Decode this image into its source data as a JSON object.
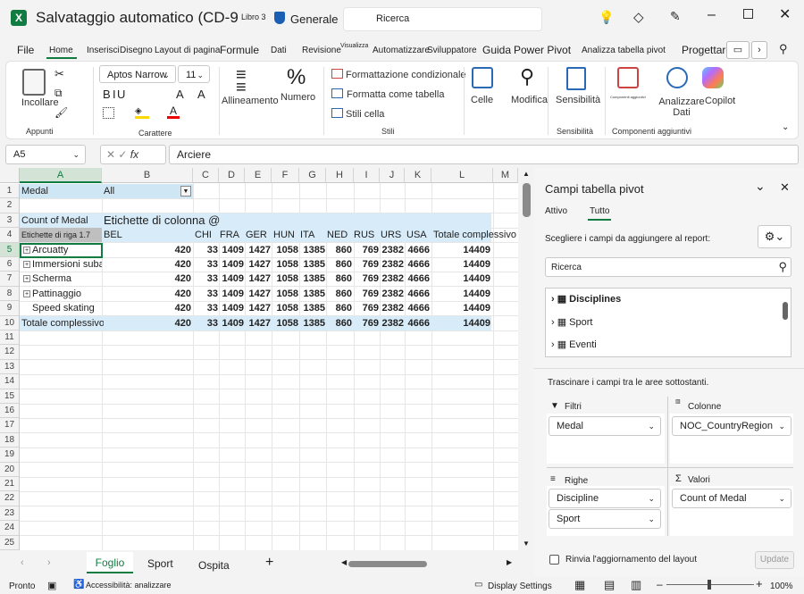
{
  "titlebar": {
    "app_icon": "excel-icon",
    "title": "Salvataggio automatico (CD-9",
    "file_badge": "Libro 3",
    "sensitivity": "Generale p",
    "search_placeholder": "Ricerca",
    "icons": [
      "lightbulb-icon",
      "diamond-icon",
      "pen-icon",
      "minimize-icon",
      "maximize-icon",
      "close-icon"
    ]
  },
  "tabs": [
    "File",
    "Home",
    "Inserisci",
    "Disegno",
    "Layout di pagina",
    "Formule",
    "Dati",
    "Revisione",
    "Visualizza",
    "Automatizzare",
    "Sviluppatore",
    "Guida",
    "Power Pivot",
    "Analizza tabella pivot",
    "Progettare"
  ],
  "ribbon": {
    "clipboard": {
      "paste_label": "Incollare",
      "group_label": "Appunti"
    },
    "font": {
      "font_name": "Aptos Narrow",
      "font_size": "11",
      "bold": "B",
      "italic": "I",
      "underline": "U",
      "grow": "A",
      "shrink": "A",
      "group_label": "Carattere"
    },
    "alignment": {
      "label": "Allineamento"
    },
    "number": {
      "label": "Numero"
    },
    "styles": {
      "conditional": "Formattazione condizionale",
      "as_table": "Formatta come tabella",
      "cell_styles": "Stili cella",
      "group_label": "Stili"
    },
    "cells": {
      "label": "Celle"
    },
    "edit": {
      "label": "Modifica"
    },
    "sensitivity": {
      "label": "Sensibilità",
      "group_label": "Sensibilità"
    },
    "addins": {
      "label": "Componenti aggiuntivi",
      "group_label": "Componenti aggiuntivi"
    },
    "analyze": {
      "label": "Analizzare Dati"
    },
    "copilot": {
      "label": "Copilot"
    }
  },
  "formulabar": {
    "namebox": "A5",
    "fx": "fx",
    "value": "Arciere"
  },
  "columns": [
    "A",
    "B",
    "C",
    "D",
    "E",
    "F",
    "G",
    "H",
    "I",
    "J",
    "K",
    "L",
    "M"
  ],
  "rows": [
    "1",
    "2",
    "3",
    "4",
    "5",
    "6",
    "7",
    "8",
    "9",
    "10",
    "11",
    "12",
    "13",
    "14",
    "15",
    "16",
    "17",
    "18",
    "19",
    "20",
    "21",
    "22",
    "23",
    "24",
    "25"
  ],
  "pivot": {
    "filter_label": "Medal",
    "filter_value": "All",
    "count_label": "Count of Medal",
    "col_labels": "Etichette di colonna @",
    "row_labels": "Etichette di riga 1.7",
    "headers": [
      "BEL",
      "CHI",
      "FRA",
      "GER",
      "HUN",
      "ITA",
      "NED",
      "RUS",
      "URS",
      "USA",
      "Totale complessivo"
    ],
    "rows": [
      {
        "label": "Arcuatty",
        "values": [
          "420",
          "33",
          "1409",
          "1427",
          "1058",
          "1385",
          "860",
          "769",
          "2382",
          "4666",
          "14409"
        ]
      },
      {
        "label": "Immersioni subacquee",
        "values": [
          "420",
          "33",
          "1409",
          "1427",
          "1058",
          "1385",
          "860",
          "769",
          "2382",
          "4666",
          "14409"
        ]
      },
      {
        "label": "Scherma",
        "values": [
          "420",
          "33",
          "1409",
          "1427",
          "1058",
          "1385",
          "860",
          "769",
          "2382",
          "4666",
          "14409"
        ]
      },
      {
        "label": "Pattinaggio",
        "values": [
          "420",
          "33",
          "1409",
          "1427",
          "1058",
          "1385",
          "860",
          "769",
          "2382",
          "4666",
          "14409"
        ]
      },
      {
        "label": "Speed skating",
        "values": [
          "420",
          "33",
          "1409",
          "1427",
          "1058",
          "1385",
          "860",
          "769",
          "2382",
          "4666",
          "14409"
        ]
      }
    ],
    "total_label": "Totale complessivo",
    "total_values": [
      "420",
      "33",
      "1409",
      "1427",
      "1058",
      "1385",
      "860",
      "769",
      "2382",
      "4666",
      "14409"
    ]
  },
  "sheets": [
    "Foglio",
    "Sport",
    "Ospita"
  ],
  "status": {
    "ready": "Pronto",
    "accessibility": "Accessibilità: analizzare",
    "display": "Display Settings",
    "zoom": "100%"
  },
  "pane": {
    "title": "Campi tabella pivot",
    "tab_active": "Attivo",
    "tab_all": "Tutto",
    "choose_label": "Scegliere i campi da aggiungere al report:",
    "search_placeholder": "Ricerca",
    "fields": [
      "Disciplines",
      "Sport",
      "Eventi"
    ],
    "drag_label": "Trascinare i campi tra le aree sottostanti.",
    "filters_label": "Filtri",
    "columns_label": "Colonne",
    "rows_label": "Righe",
    "values_label": "Valori",
    "filter_item": "Medal",
    "column_item": "NOC_CountryRegion",
    "row_items": [
      "Discipline",
      "Sport"
    ],
    "value_item": "Count of Medal",
    "defer_label": "Rinvia l'aggiornamento del layout",
    "update_label": "Update"
  }
}
